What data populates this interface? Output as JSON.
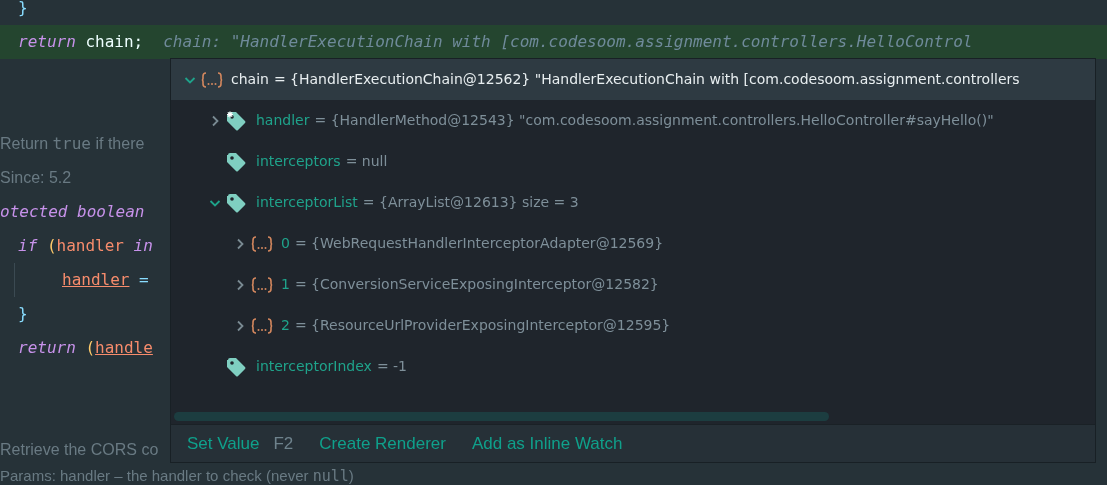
{
  "editor": {
    "lines": [
      {
        "kind": "block",
        "children": [
          {
            "kind": "code",
            "tokens": [
              {
                "text": "}",
                "kind": "brace"
              }
            ]
          },
          {
            "kind": "code",
            "highlighted": true,
            "tokens": [
              {
                "text": "return",
                "kind": "keyword"
              },
              {
                "text": " chain;",
                "kind": "plain"
              }
            ],
            "inline_hint": "chain: \"HandlerExecutionChain with [com.codesoom.assignment.controllers.HelloControl"
          }
        ]
      },
      {
        "kind": "blank"
      },
      {
        "kind": "blank"
      },
      {
        "kind": "doc",
        "tokens": [
          {
            "text": "Return ",
            "kind": "doc"
          },
          {
            "text": "true",
            "kind": "doc_code"
          },
          {
            "text": " if there",
            "kind": "doc"
          }
        ]
      },
      {
        "kind": "doc",
        "tokens": [
          {
            "text": "Since: ",
            "kind": "doc"
          },
          {
            "text": "5.2",
            "kind": "doc"
          }
        ]
      },
      {
        "kind": "code",
        "highlighted": false,
        "tokens": [
          {
            "text": "otected boolean",
            "kind": "keyword"
          }
        ],
        "children": [
          {
            "kind": "code",
            "highlighted": false,
            "tokens": [
              {
                "text": "if",
                "kind": "keyword"
              },
              {
                "text": " (",
                "kind": "paren"
              },
              {
                "text": "handler",
                "kind": "param"
              },
              {
                "text": " in",
                "kind": "keyword"
              }
            ],
            "children": [
              {
                "kind": "code",
                "highlighted": false,
                "tokens": [
                  {
                    "text": "handler",
                    "kind": "param_underlined"
                  },
                  {
                    "text": " =",
                    "kind": "operator"
                  }
                ]
              }
            ]
          },
          {
            "kind": "code",
            "highlighted": false,
            "tokens": [
              {
                "text": "}",
                "kind": "brace"
              }
            ]
          },
          {
            "kind": "code",
            "highlighted": false,
            "tokens": [
              {
                "text": "return",
                "kind": "keyword"
              },
              {
                "text": " (",
                "kind": "paren"
              },
              {
                "text": "handle",
                "kind": "param_underlined"
              }
            ]
          }
        ]
      },
      {
        "kind": "blank"
      },
      {
        "kind": "blank"
      },
      {
        "kind": "doc",
        "tokens": [
          {
            "text": "Retrieve the CORS co",
            "kind": "doc"
          }
        ]
      },
      {
        "kind": "doc",
        "tokens": [
          {
            "text": "Params: handler – the handler to check (never ",
            "kind": "doc"
          },
          {
            "text": "null",
            "kind": "doc_code"
          },
          {
            "text": ")",
            "kind": "doc"
          }
        ]
      }
    ]
  },
  "debug_popup": {
    "tree": [
      {
        "name": "chain",
        "value": "= {HandlerExecutionChain@12562} \"HandlerExecutionChain with [com.codesoom.assignment.controllers",
        "kind": "object",
        "expanded": true,
        "selected": true,
        "children": [
          {
            "name": "handler",
            "value": "= {HandlerMethod@12543} \"com.codesoom.assignment.controllers.HelloController#sayHello()\"",
            "kind": "final_field",
            "expanded": false,
            "selected": false
          },
          {
            "name": "interceptors",
            "value": "= null",
            "kind": "field",
            "selected": false
          },
          {
            "name": "interceptorList",
            "value": "= {ArrayList@12613}  size = 3",
            "kind": "field",
            "expanded": true,
            "selected": false,
            "children": [
              {
                "name": "0",
                "value": "= {WebRequestHandlerInterceptorAdapter@12569}",
                "kind": "object",
                "expanded": false,
                "selected": false
              },
              {
                "name": "1",
                "value": "= {ConversionServiceExposingInterceptor@12582}",
                "kind": "object",
                "expanded": false,
                "selected": false
              },
              {
                "name": "2",
                "value": "= {ResourceUrlProviderExposingInterceptor@12595}",
                "kind": "object",
                "expanded": false,
                "selected": false
              }
            ]
          },
          {
            "name": "interceptorIndex",
            "value": "= -1",
            "kind": "field",
            "selected": false
          }
        ]
      }
    ],
    "actions": [
      {
        "label": "Set Value",
        "shortcut": "F2"
      },
      {
        "label": "Create Renderer"
      },
      {
        "label": "Add as Inline Watch"
      }
    ]
  }
}
